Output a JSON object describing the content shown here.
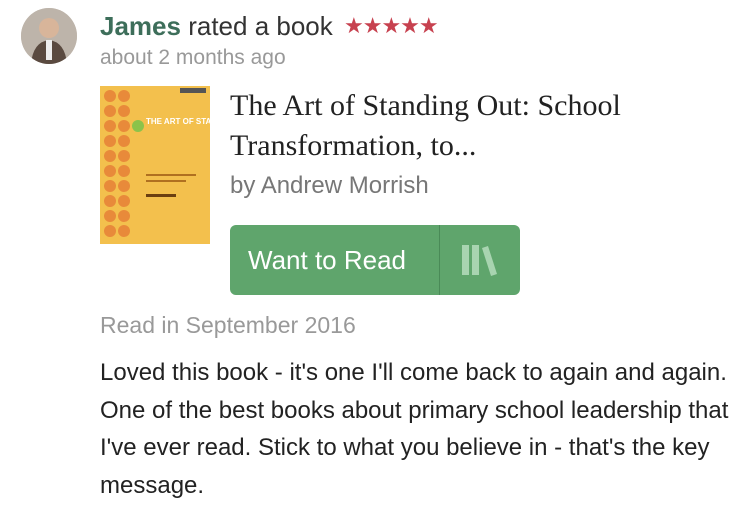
{
  "activity": {
    "user_name": "James",
    "action": "rated a book",
    "rating": 5,
    "stars_display": "★★★★★",
    "timestamp": "about 2 months ago"
  },
  "book": {
    "title": "The Art of Standing Out: School Transformation, to...",
    "author": "by Andrew Morrish",
    "cover_text": "THE ART OF STANDING OUT",
    "cover_color": "#f3c04d"
  },
  "shelf_button": {
    "label": "Want to Read",
    "icon": "bookshelf-icon",
    "color": "#5fa56c"
  },
  "read_date": "Read in September 2016",
  "review_text": "Loved this book - it's one I'll come back to again and again. One of the best books about primary school leadership that I've ever read. Stick to what you believe in - that's the key message."
}
